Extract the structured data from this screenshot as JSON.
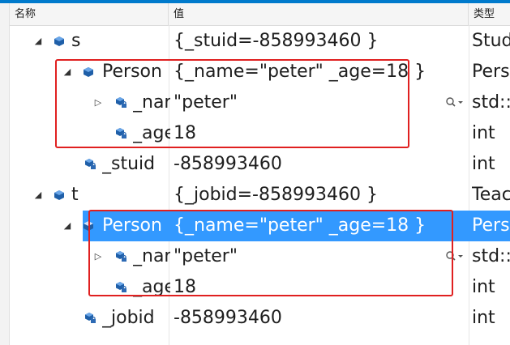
{
  "header": {
    "col_name": "名称",
    "col_value": "值",
    "col_type": "类型"
  },
  "rows": [
    {
      "name": "s",
      "value": "{_stuid=-858993460 }",
      "type": "Stud",
      "expander": "expanded",
      "icon": "object-icon"
    },
    {
      "name": "Person",
      "value": "{_name=\"peter\" _age=18 }",
      "type": "Pers",
      "expander": "expanded",
      "icon": "object-icon"
    },
    {
      "name": "_nar",
      "value": "\"peter\"",
      "type": "std::",
      "expander": "collapsed",
      "icon": "private-field-icon"
    },
    {
      "name": "_age",
      "value": "18",
      "type": "int",
      "expander": "none",
      "icon": "private-field-icon"
    },
    {
      "name": "_stuid",
      "value": "-858993460",
      "type": "int",
      "expander": "none",
      "icon": "private-field-icon"
    },
    {
      "name": "t",
      "value": "{_jobid=-858993460 }",
      "type": "Teac",
      "expander": "expanded",
      "icon": "object-icon"
    },
    {
      "name": "Person",
      "value": "{_name=\"peter\" _age=18 }",
      "type": "Pers",
      "expander": "expanded",
      "icon": "object-icon",
      "selected": true
    },
    {
      "name": "_nar",
      "value": "\"peter\"",
      "type": "std::",
      "expander": "collapsed",
      "icon": "private-field-icon"
    },
    {
      "name": "_age",
      "value": "18",
      "type": "int",
      "expander": "none",
      "icon": "private-field-icon"
    },
    {
      "name": "_jobid",
      "value": "-858993460",
      "type": "int",
      "expander": "none",
      "icon": "private-field-icon"
    }
  ],
  "colors": {
    "accent": "#007acc",
    "selection": "#3399ff",
    "highlight_box": "#e02020"
  }
}
